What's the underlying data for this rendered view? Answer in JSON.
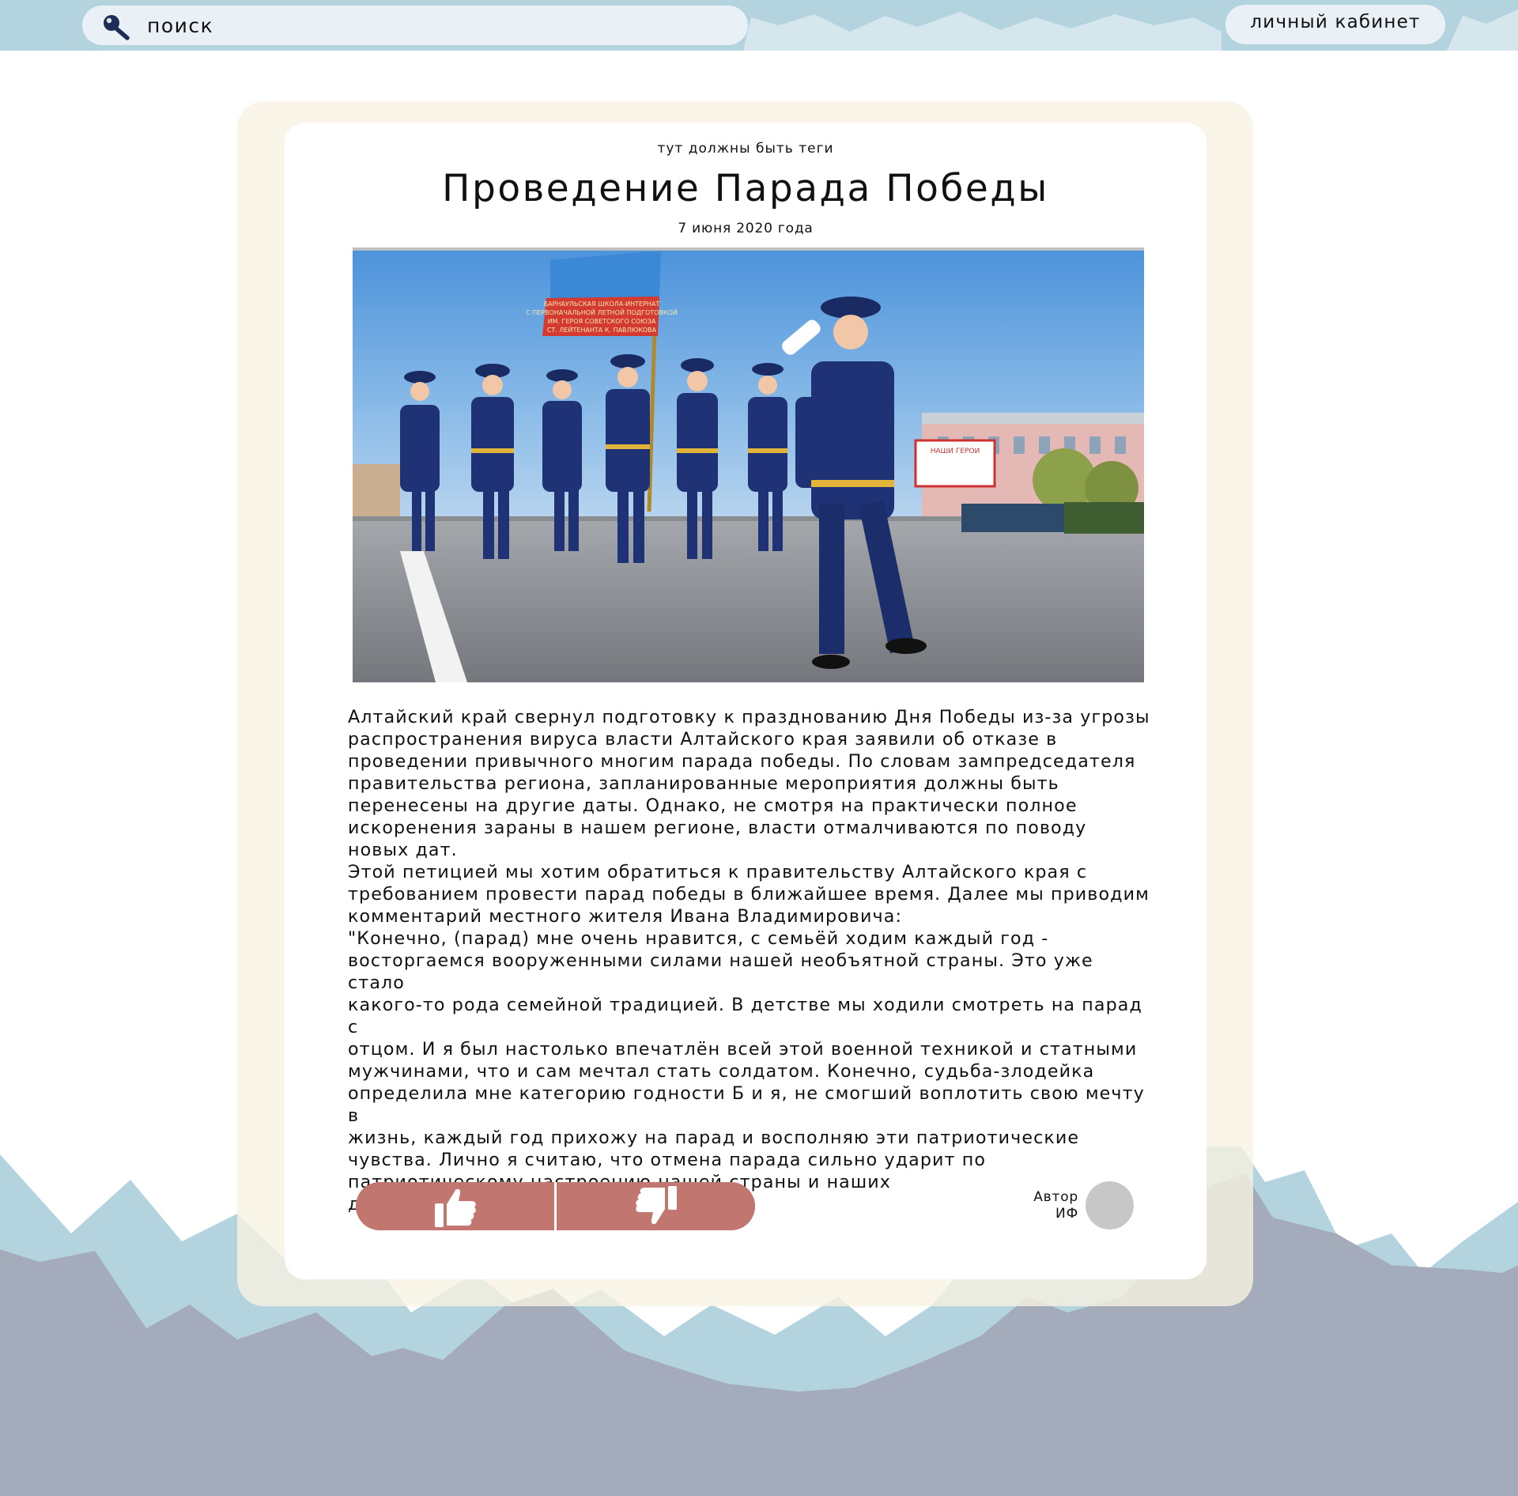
{
  "header": {
    "search_placeholder": "поиск",
    "cabinet_label": "личный кабинет"
  },
  "article": {
    "tags": "тут должны быть теги",
    "title": "Проведение Парада Победы",
    "date": "7 июня 2020 года",
    "photo": {
      "banner_lines": [
        "БАРНАУЛЬСКАЯ ШКОЛА-ИНТЕРНАТ",
        "С ПЕРВОНАЧАЛЬНОЙ ЛЕТНОЙ ПОДГОТОВКОЙ",
        "ИМ. ГЕРОЯ СОВЕТСКОГО СОЮЗА",
        "СТ. ЛЕЙТЕНАНТА К. ПАВЛЮКОВА"
      ],
      "billboard_text": "НАШИ ГЕРОИ"
    },
    "body": "Алтайский край свернул подготовку к празднованию Дня Победы из-за угрозы\nраспространения вируса власти Алтайского края заявили об отказе в\nпроведении привычного многим парада победы. По словам зампредседателя\nправительства региона, запланированные мероприятия должны быть\nперенесены на другие даты. Однако, не смотря на практически полное\nискоренения  зараны в нашем регионе, власти отмалчиваются по поводу\nновых дат.\nЭтой петицией мы хотим обратиться к правительству Алтайского края с\nтребованием провести  парад победы в ближайшее время. Далее мы приводим\nкомментарий местного жителя Ивана Владимировича:\n\"Конечно, (парад) мне очень нравится, с семьёй ходим каждый год -\nвосторгаемся вооруженными силами нашей необъятной страны. Это уже стало\nкакого-то рода семейной традицией. В детстве мы ходили смотреть на парад с\nотцом. И я был настолько впечатлён всей этой военной техникой и статными\nмужчинами, что и сам мечтал стать солдатом. Конечно, судьба-злодейка\nопределила мне категорию годности Б и я, не смогший воплотить свою мечту в\nжизнь, каждый год прихожу на парад и восполняю эти патриотические\nчувства. Лично я считаю, что отмена парада сильно ударит по\nпатриотическому настроению нашей страны и наших\nдетей. Парад должен быть!\"",
    "author_label": "Автор",
    "author_initials": "ИФ"
  },
  "icons": {
    "search": "search-icon",
    "like": "thumbs-up-icon",
    "dislike": "thumbs-down-icon",
    "avatar": "avatar"
  },
  "colors": {
    "header_bg": "#b3d3df",
    "search_bg": "#e9f1f6",
    "search_icon": "#1c2e57",
    "frame_bg": "#f8f3e2",
    "vote_bg": "#c27670",
    "avatar_bg": "#c7c7c7",
    "mountain_light": "#b3d3df",
    "mountain_dark": "#a4abba"
  }
}
